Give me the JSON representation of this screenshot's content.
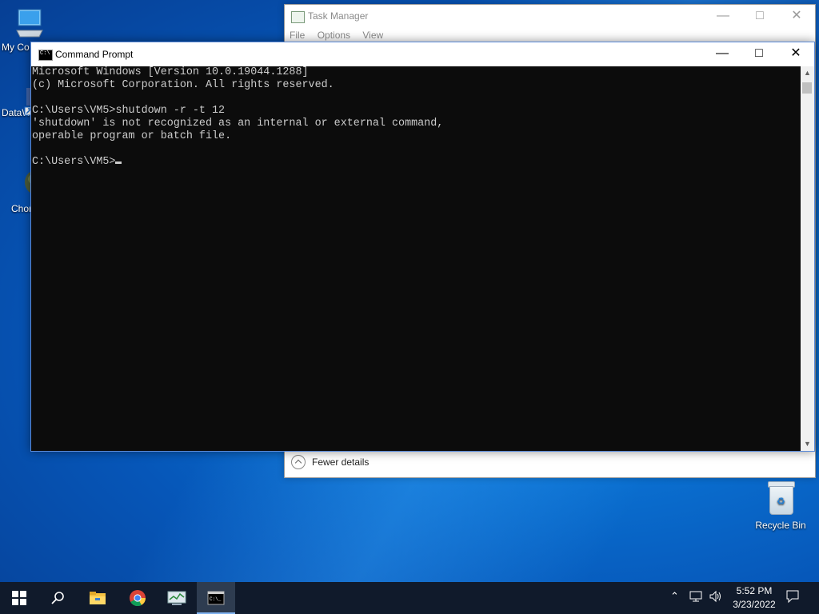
{
  "desktop": {
    "icons": [
      {
        "label": "My Co"
      },
      {
        "label": "DataW"
      },
      {
        "label": "Chor"
      }
    ],
    "recycle_bin_label": "Recycle Bin"
  },
  "task_manager": {
    "title": "Task Manager",
    "menu": [
      "File",
      "Options",
      "View"
    ],
    "fewer_details": "Fewer details"
  },
  "command_prompt": {
    "title": "Command Prompt",
    "lines": [
      "Microsoft Windows [Version 10.0.19044.1288]",
      "(c) Microsoft Corporation. All rights reserved.",
      "",
      "C:\\Users\\VM5>shutdown -r -t 12",
      "'shutdown' is not recognized as an internal or external command,",
      "operable program or batch file.",
      ""
    ],
    "prompt": "C:\\Users\\VM5>"
  },
  "taskbar": {
    "time": "5:52 PM",
    "date": "3/23/2022",
    "apps": [
      "start-icon",
      "search-icon",
      "file-explorer-icon",
      "chrome-icon",
      "task-manager-icon",
      "command-prompt-icon"
    ]
  },
  "colors": {
    "console_bg": "#0c0c0c",
    "console_text": "#cccccc",
    "taskbar_bg": "#101a2b",
    "accent": "#0a6fd0"
  }
}
